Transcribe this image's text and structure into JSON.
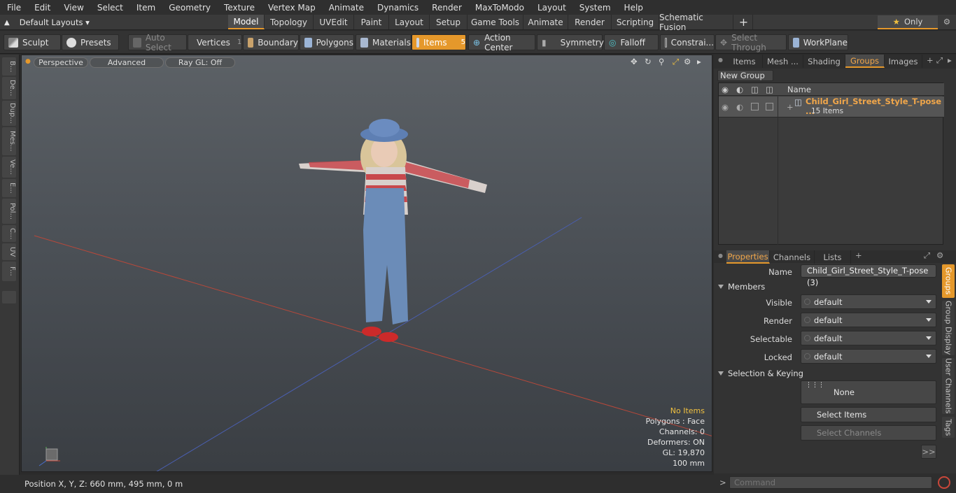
{
  "menu": [
    "File",
    "Edit",
    "View",
    "Select",
    "Item",
    "Geometry",
    "Texture",
    "Vertex Map",
    "Animate",
    "Dynamics",
    "Render",
    "MaxToModo",
    "Layout",
    "System",
    "Help"
  ],
  "layouts": {
    "label": "Default Layouts"
  },
  "mode_tabs": [
    "Model",
    "Topology",
    "UVEdit",
    "Paint",
    "Layout",
    "Setup",
    "Game Tools",
    "Animate",
    "Render",
    "Scripting",
    "Schematic Fusion"
  ],
  "only_label": "Only",
  "toolbar": {
    "sculpt": "Sculpt",
    "presets": "Presets",
    "auto_select": "Auto Select",
    "vertices": "Vertices",
    "vertices_count": "1",
    "boundary": "Boundary",
    "polygons": "Polygons",
    "materials": "Materials",
    "items": "Items",
    "items_count": "5",
    "action_center": "Action Center",
    "symmetry": "Symmetry",
    "falloff": "Falloff",
    "constraints": "Constrai...",
    "select_through": "Select Through",
    "workplane": "WorkPlane"
  },
  "left_tabs": [
    "B...",
    "De...",
    "Dup...",
    "Mes...",
    "Ve...",
    "E...",
    "Pol...",
    "C...",
    "UV",
    "F..."
  ],
  "viewport": {
    "perspective": "Perspective",
    "advanced": "Advanced",
    "raygl": "Ray GL: Off",
    "hud": {
      "no_items": "No Items",
      "polygons": "Polygons : Face",
      "channels": "Channels: 0",
      "deformers": "Deformers: ON",
      "gl": "GL: 19,870",
      "scale": "100 mm"
    }
  },
  "status": {
    "position": "Position X, Y, Z:  660 mm, 495 mm, 0 m"
  },
  "top_panel": {
    "tabs": [
      "Items",
      "Mesh ...",
      "Shading",
      "Groups",
      "Images"
    ],
    "new_group": "New Group",
    "name_header": "Name",
    "group_name": "Child_Girl_Street_Style_T-pose ...",
    "group_count": "15 Items"
  },
  "props": {
    "tabs": [
      "Properties",
      "Channels",
      "Lists"
    ],
    "name_label": "Name",
    "name_value": "Child_Girl_Street_Style_T-pose (3)",
    "members": "Members",
    "visible_label": "Visible",
    "visible": "default",
    "render_label": "Render",
    "render": "default",
    "selectable_label": "Selectable",
    "selectable": "default",
    "locked_label": "Locked",
    "locked": "default",
    "selkey": "Selection & Keying",
    "none": "None",
    "select_items": "Select Items",
    "select_channels": "Select Channels",
    "more": ">>",
    "side_tabs": [
      "Groups",
      "Group Display",
      "User Channels",
      "Tags"
    ]
  },
  "command": {
    "prompt": ">",
    "placeholder": "Command"
  },
  "colors": {
    "accent": "#e5982b",
    "group_name": "#f0a64a"
  }
}
